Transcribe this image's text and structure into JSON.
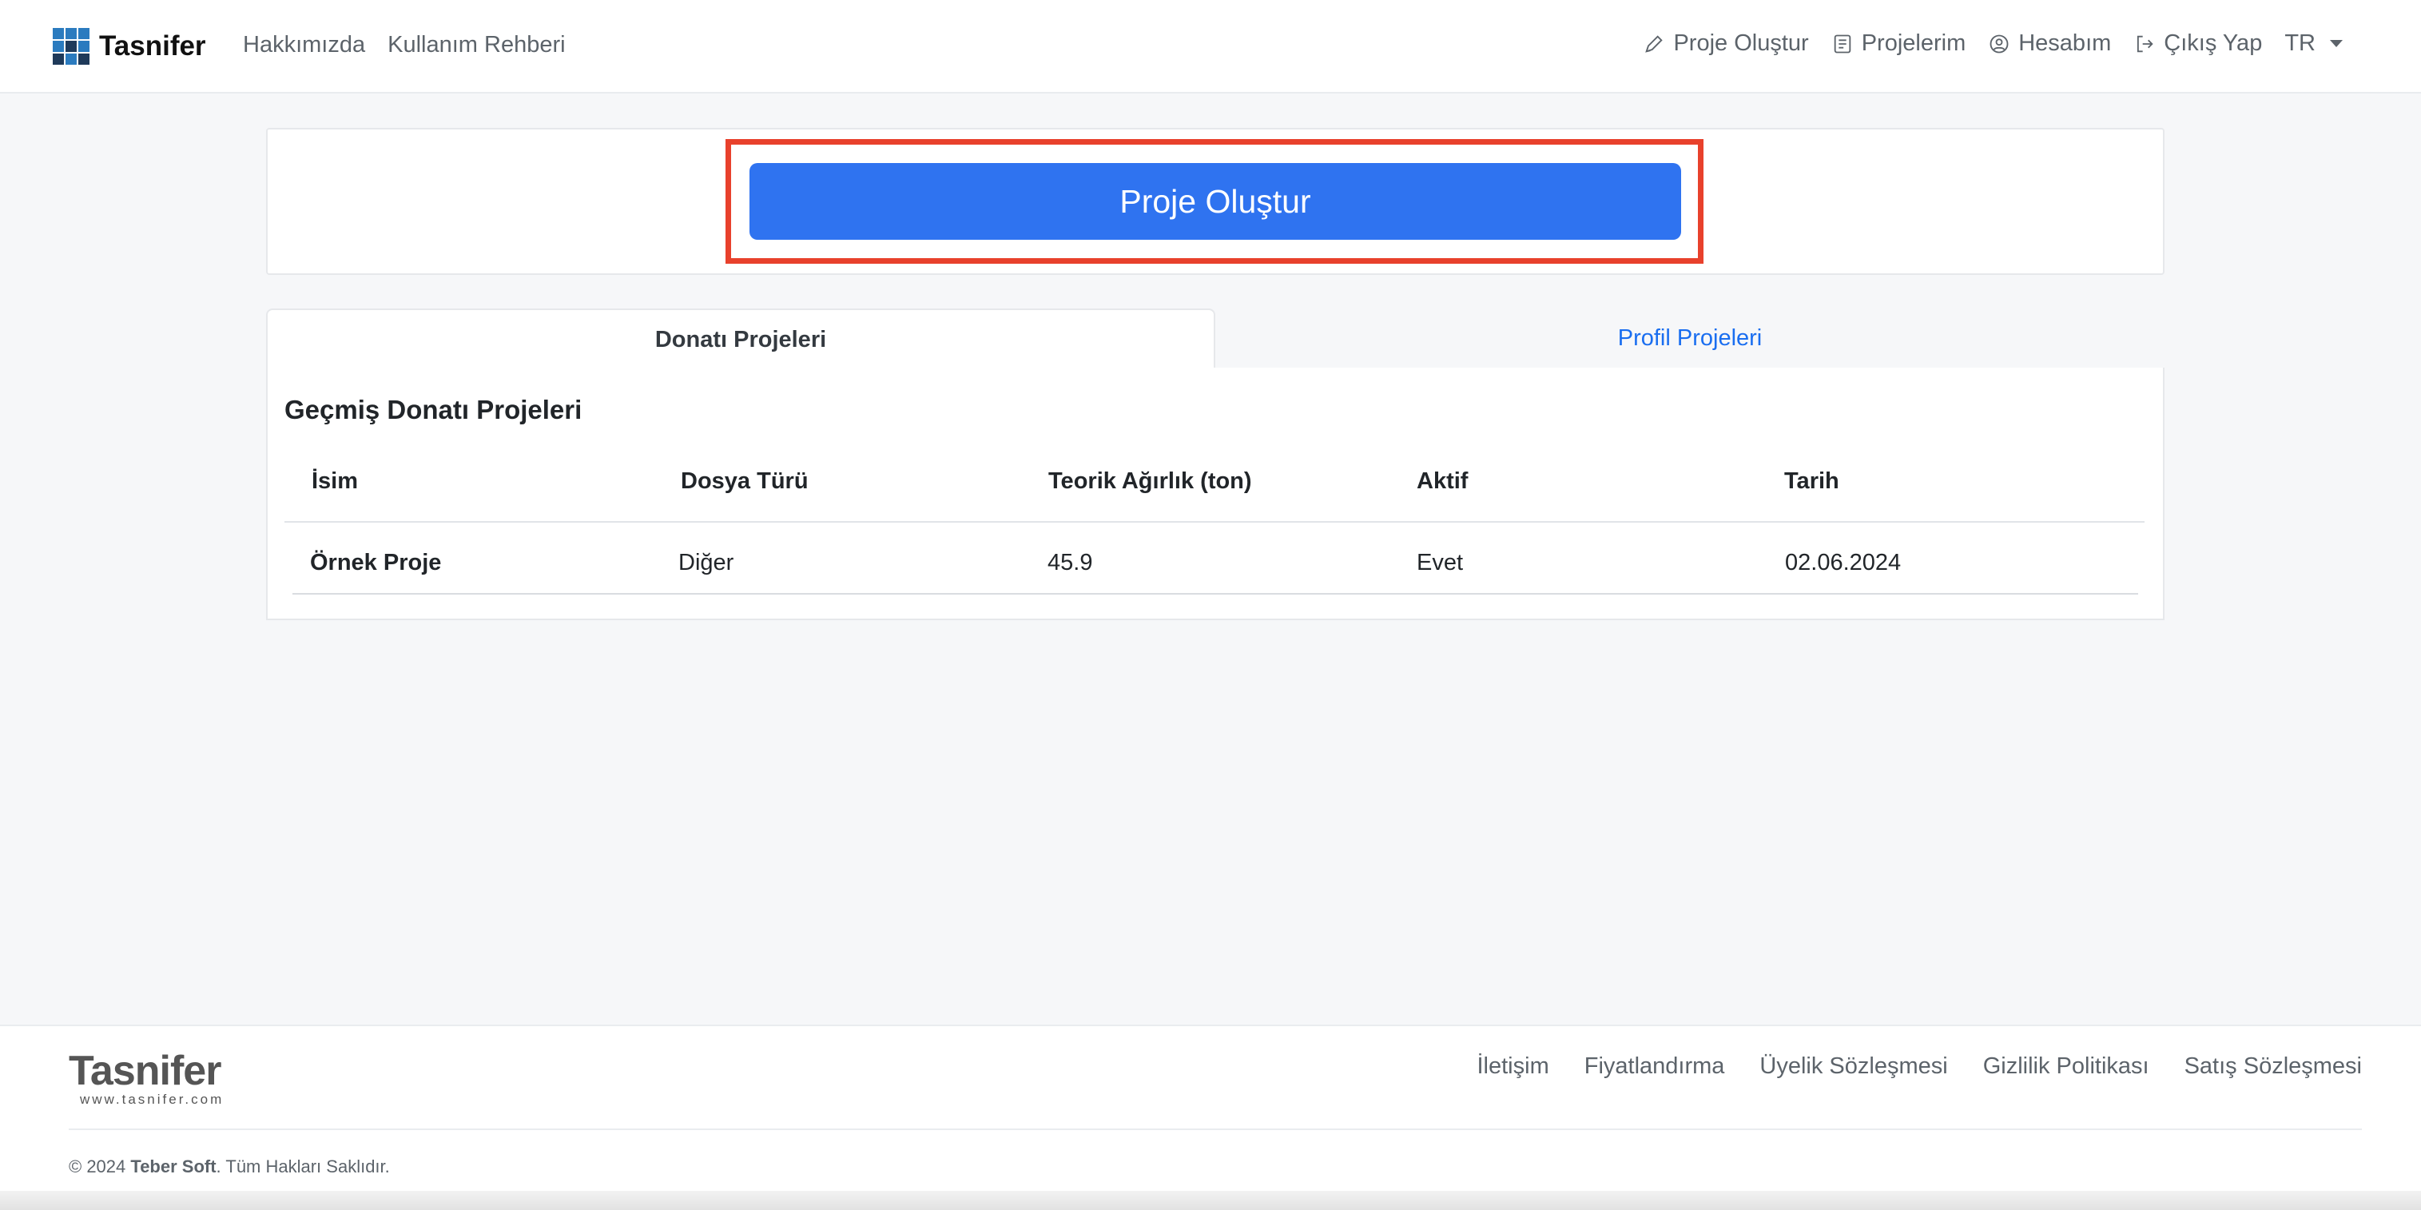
{
  "colors": {
    "primary": "#2f73f0",
    "link": "#1a6ef0",
    "highlight": "#e8412c",
    "logo_blue": "#2b7bbf",
    "logo_dark": "#1f3a5a"
  },
  "navbar": {
    "brand": "Tasnifer",
    "left_links": [
      "Hakkımızda",
      "Kullanım Rehberi"
    ],
    "right_items": [
      {
        "label": "Proje Oluştur",
        "icon": "pencil-icon"
      },
      {
        "label": "Projelerim",
        "icon": "document-list-icon"
      },
      {
        "label": "Hesabım",
        "icon": "user-circle-icon"
      },
      {
        "label": "Çıkış Yap",
        "icon": "logout-icon"
      }
    ],
    "language": "TR"
  },
  "create": {
    "button_label": "Proje Oluştur"
  },
  "tabs": [
    {
      "label": "Donatı Projeleri",
      "active": true
    },
    {
      "label": "Profil Projeleri",
      "active": false
    }
  ],
  "projects": {
    "title": "Geçmiş Donatı Projeleri",
    "columns": [
      "İsim",
      "Dosya Türü",
      "Teorik Ağırlık (ton)",
      "Aktif",
      "Tarih"
    ],
    "rows": [
      [
        "Örnek Proje",
        "Diğer",
        "45.9",
        "Evet",
        "02.06.2024"
      ]
    ]
  },
  "footer": {
    "logo_name": "Tasnifer",
    "logo_url": "www.tasnifer.com",
    "links": [
      "İletişim",
      "Fiyatlandırma",
      "Üyelik Sözleşmesi",
      "Gizlilik Politikası",
      "Satış Sözleşmesi"
    ],
    "copyright_prefix": "© 2024 ",
    "copyright_company": "Teber Soft",
    "copyright_suffix": ". Tüm Hakları Saklıdır."
  }
}
